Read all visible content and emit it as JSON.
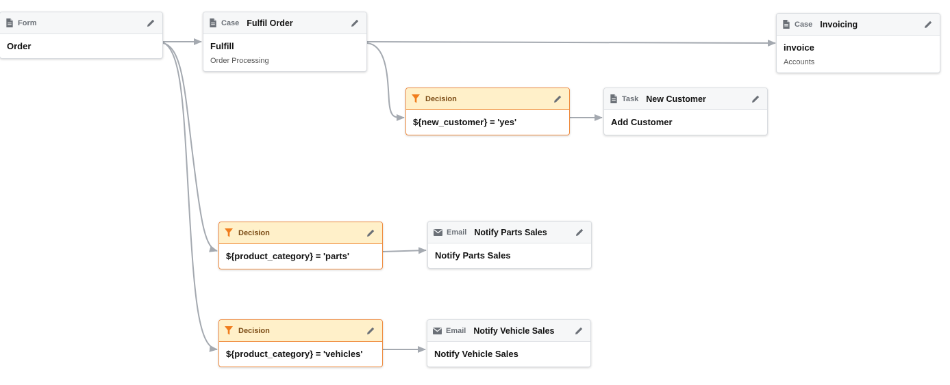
{
  "nodes": {
    "order": {
      "type": "Form",
      "title": "",
      "name": "Order",
      "sub": ""
    },
    "fulfil": {
      "type": "Case",
      "title": "Fulfil Order",
      "name": "Fulfill",
      "sub": "Order Processing"
    },
    "invoicing": {
      "type": "Case",
      "title": "Invoicing",
      "name": "invoice",
      "sub": "Accounts"
    },
    "decision_customer": {
      "type": "Decision",
      "name": "${new_customer} = 'yes'"
    },
    "new_customer": {
      "type": "Task",
      "title": "New Customer",
      "name": "Add Customer"
    },
    "decision_parts": {
      "type": "Decision",
      "name": "${product_category} = 'parts'"
    },
    "notify_parts": {
      "type": "Email",
      "title": "Notify Parts Sales",
      "name": "Notify Parts Sales"
    },
    "decision_vehicles": {
      "type": "Decision",
      "name": "${product_category} = 'vehicles'"
    },
    "notify_vehicles": {
      "type": "Email",
      "title": "Notify Vehicle Sales",
      "name": "Notify Vehicle Sales"
    }
  },
  "icons": {
    "document": "document-icon",
    "decision": "funnel-icon",
    "email": "envelope-icon",
    "edit": "pencil-icon"
  },
  "colors": {
    "edge": "#a4a9b0",
    "decision_border": "#ef8a3c",
    "decision_header": "#fff0c9",
    "decision_icon": "#f07d1e"
  }
}
